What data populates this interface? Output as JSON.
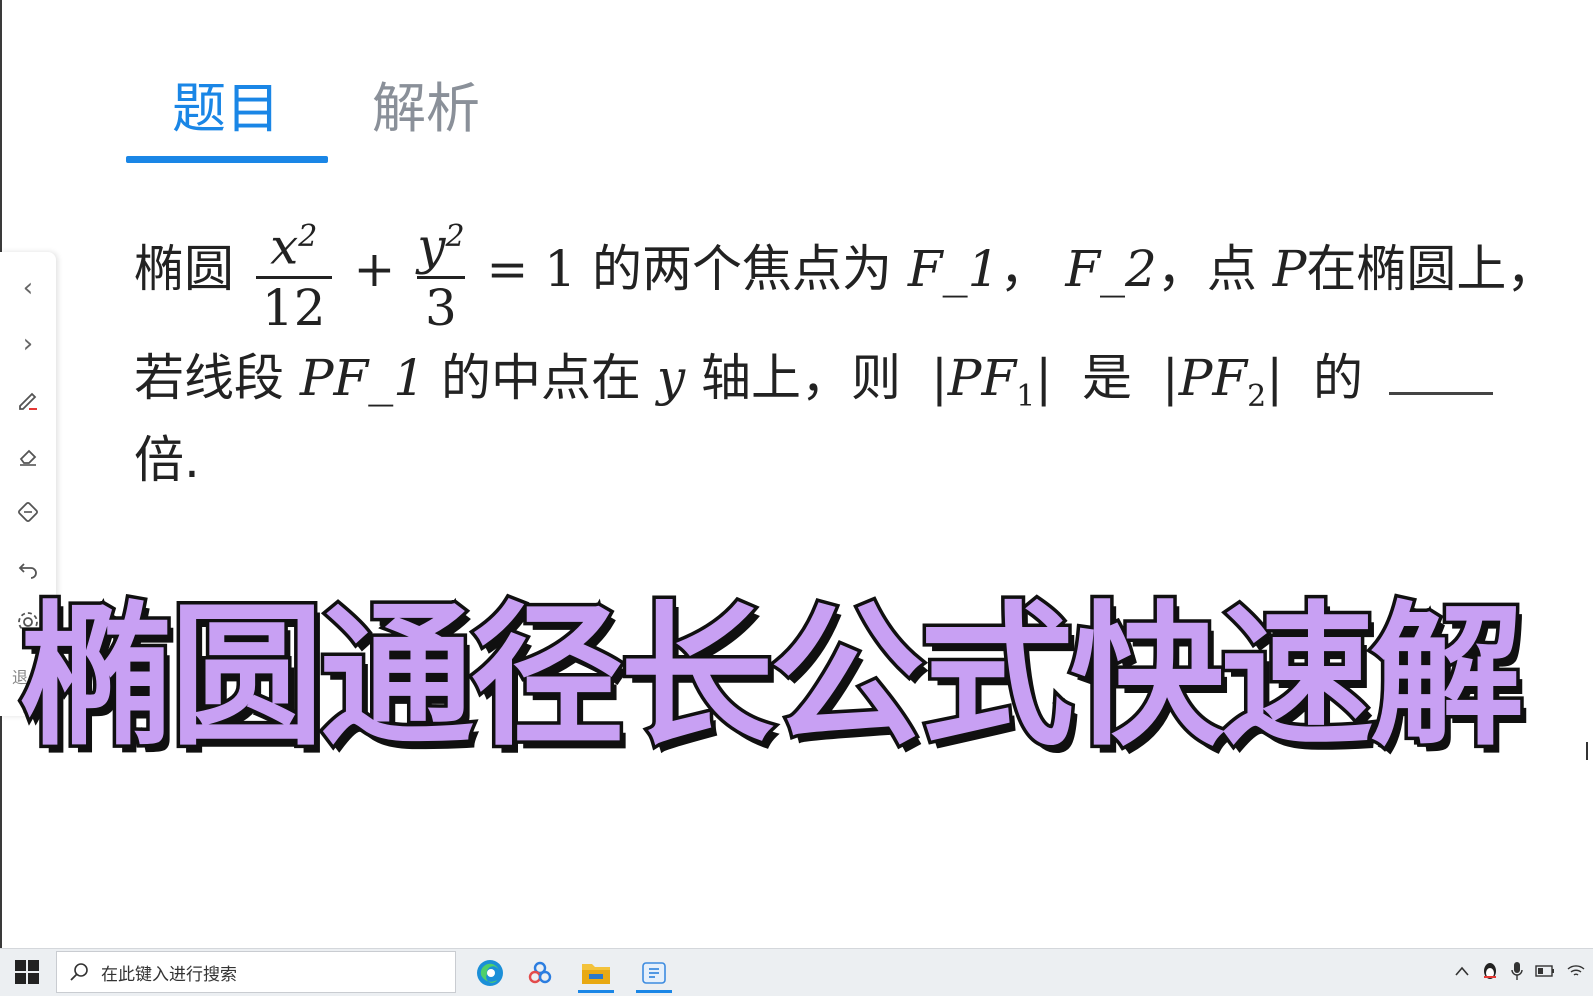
{
  "tabs": {
    "active": "题目",
    "inactive": "解析"
  },
  "question": {
    "line1_prefix": "椭圆",
    "frac1_num": "x",
    "frac1_den": "12",
    "plus": "+",
    "frac2_num": "y",
    "frac2_den": "3",
    "exp": "2",
    "equals_one": "= 1",
    "line1_mid": "的两个焦点为",
    "F1": "F_1",
    "comma": "，",
    "F2": "F_2",
    "line1_point": "，点",
    "P": "P",
    "line1_suffix": "在椭圆上，",
    "line2_prefix": "若线段",
    "PF1_var": "PF_1",
    "line2_mid": "的中点在",
    "y_var": "y",
    "line2_axis": "轴上，则",
    "abs_open": "|",
    "abs_PF": "PF",
    "sub1": "1",
    "sub2": "2",
    "abs_close": "|",
    "shi": "是",
    "de": "的",
    "line3": "倍."
  },
  "toolbar": {
    "label": "退",
    "prev": "‹",
    "next": "›"
  },
  "overlay_title": "椭圆通径长公式快速解",
  "taskbar": {
    "search_placeholder": "在此键入进行搜索"
  },
  "colors": {
    "accent": "#1a86e6",
    "overlay_fill": "#c8a0f3",
    "overlay_stroke": "#101010"
  }
}
